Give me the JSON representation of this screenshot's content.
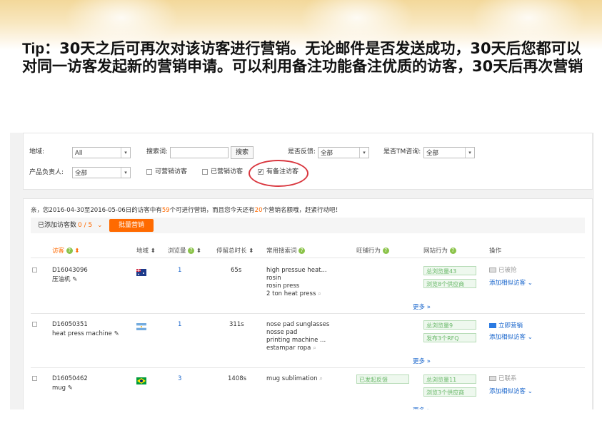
{
  "tip": {
    "prefix": "Tip：",
    "text": "30天之后可再次对该访客进行营销。无论邮件是否发送成功，30天后您都可以对同一访客发起新的营销申请。可以利用备注功能备注优质的访客，30天后再次营销"
  },
  "filters": {
    "region_label": "地域:",
    "region_value": "All",
    "search_label": "搜索词:",
    "search_value": "",
    "search_button": "搜索",
    "feedback_label": "是否反馈:",
    "feedback_value": "全部",
    "tm_label": "是否TM咨询:",
    "tm_value": "全部",
    "owner_label": "产品负责人:",
    "owner_value": "全部",
    "cb_marketable": "可营销访客",
    "cb_marketed": "已营销访客",
    "cb_remarked": "有备注访客"
  },
  "notice": {
    "part1": "亲，您2016-04-30至2016-05-06日的访客中有",
    "count1": "59",
    "part2": "个可进行营销，而且您今天还有",
    "count2": "20",
    "part3": "个营销名额哦，赶紧行动吧！"
  },
  "toolbar": {
    "added_label": "已添加访客数",
    "added_value": "0 / 5",
    "batch_button": "批量营销"
  },
  "table": {
    "headers": {
      "visitor": "访客",
      "region": "地域",
      "views": "浏览量",
      "duration": "停留总时长",
      "keywords": "常用搜索词",
      "shop": "旺铺行为",
      "site": "网站行为",
      "ops": "操作"
    },
    "rows": [
      {
        "id": "D16043096",
        "product": "压油机",
        "country": "Australia",
        "views": "1",
        "duration": "65s",
        "keywords": [
          "high pressue heat...",
          "rosin",
          "rosin press",
          "2 ton heat press"
        ],
        "shop": "",
        "site": [
          "总浏览量43",
          "浏览8个供应商"
        ],
        "status": "已被抢",
        "add_similar": "添加相似访客",
        "more": "更多"
      },
      {
        "id": "D16050351",
        "product": "heat press machine",
        "country": "Argentina",
        "views": "1",
        "duration": "311s",
        "keywords": [
          "nose pad sunglasses",
          "nosse pad",
          "printing machine ...",
          "estampar ropa"
        ],
        "shop": "",
        "site": [
          "总浏览量9",
          "发布3个RFQ"
        ],
        "status": "立即营销",
        "add_similar": "添加相似访客",
        "more": "更多"
      },
      {
        "id": "D16050462",
        "product": "mug",
        "country": "Brazil",
        "views": "3",
        "duration": "1408s",
        "keywords": [
          "mug sublimation"
        ],
        "shop": "已发起反馈",
        "site": [
          "总浏览量11",
          "浏览3个供应商"
        ],
        "status": "已联系",
        "add_similar": "添加相似访客",
        "more": "更多"
      }
    ]
  },
  "colors": {
    "accent": "#ff6a00",
    "link": "#1a66cc",
    "tag_green": "#6ab86a",
    "circle_red": "#d9363e"
  }
}
